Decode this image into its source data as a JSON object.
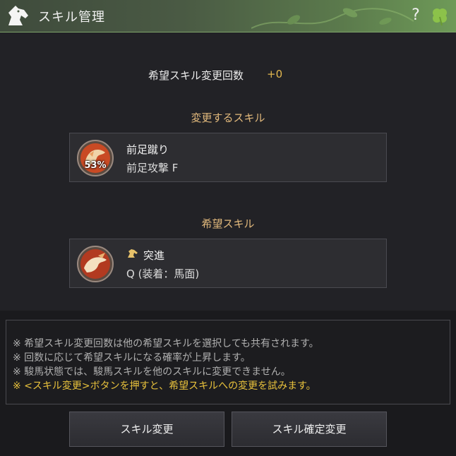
{
  "window": {
    "title": "スキル管理",
    "help_label": "?"
  },
  "change_count": {
    "label": "希望スキル変更回数",
    "value": "+0"
  },
  "current_skill": {
    "section_title": "変更するスキル",
    "name": "前足蹴り",
    "subtitle": "前足攻撃 F",
    "percent": "53%"
  },
  "desired_skill": {
    "section_title": "希望スキル",
    "name": "突進",
    "subtitle": "Q (装着：馬面)"
  },
  "notes": [
    "※ 希望スキル変更回数は他の希望スキルを選択しても共有されます。",
    "※ 回数に応じて希望スキルになる確率が上昇します。",
    "※ 駿馬状態では、駿馬スキルを他のスキルに変更できません。",
    "※ <スキル変更>ボタンを押すと、希望スキルへの変更を試みます。"
  ],
  "buttons": {
    "change_skill": "スキル変更",
    "confirm_change": "スキル確定変更"
  },
  "colors": {
    "accent_gold": "#e2b97c",
    "highlight_yellow": "#e9c23c",
    "titlebar_green": "#5b7a4c"
  },
  "icons": {
    "logo": "horse-head-icon",
    "help": "question-mark-icon",
    "clover": "four-leaf-clover-icon",
    "current_skill": "horse-kick-skill-icon",
    "desired_skill": "horse-charge-skill-icon",
    "mount": "horse-icon"
  }
}
